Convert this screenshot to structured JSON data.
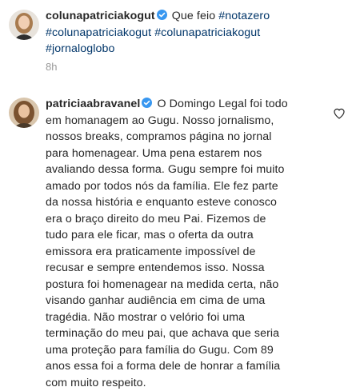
{
  "post1": {
    "username": "colunapatriciakogut",
    "text": "Que feio",
    "hashtags": [
      "#notazero",
      "#colunapatriciakogut",
      "#colunapatriciakogut",
      "#jornaloglobo"
    ],
    "timestamp": "8h"
  },
  "post2": {
    "username": "patriciaabravanel",
    "lines": [
      "O Domingo Legal foi todo",
      "em homanagem ao Gugu. Nosso jornalismo,",
      "nossos breaks, compramos página no jornal",
      "para homenagear. Uma pena estarem nos",
      "avaliando dessa forma. Gugu sempre foi muito",
      "amado por todos nós da família. Ele fez parte",
      "da nossa história e enquanto esteve conosco",
      "era o braço direito do meu Pai. Fizemos de",
      "tudo para ele ficar, mas o oferta da outra",
      "emissora era praticamente impossível de",
      "recusar e sempre entendemos isso. Nossa",
      "postura foi homenagear na medida certa, não",
      "visando ganhar audiência em cima de uma",
      "tragédia. Não mostrar o velório foi uma",
      "terminação do meu pai, que achava que seria",
      "uma proteção para família do Gugu. Com 89",
      "anos essa foi a forma dele de honrar a família",
      "com muito respeito."
    ]
  },
  "icons": {
    "verified": "verified-badge-icon",
    "like": "heart-icon"
  },
  "colors": {
    "text": "#262626",
    "hashtag": "#003569",
    "timestamp": "#999999",
    "verified": "#3897f0"
  }
}
